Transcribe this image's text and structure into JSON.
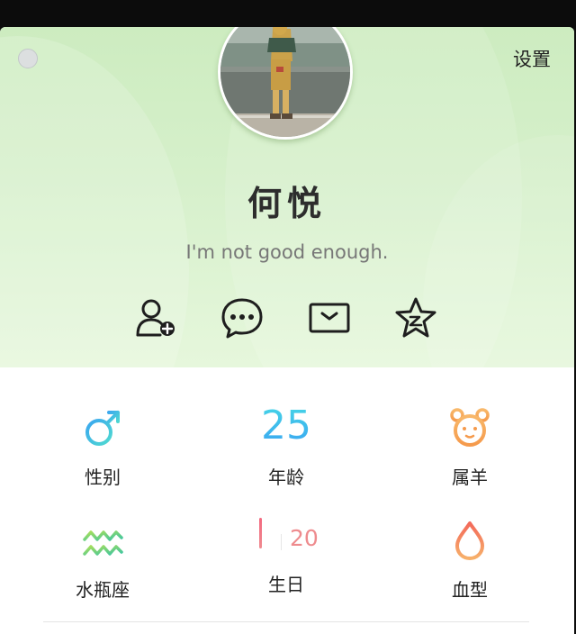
{
  "header": {
    "settings_label": "设置"
  },
  "profile": {
    "name": "何悦",
    "signature": "I'm not good enough."
  },
  "actions": [
    {
      "icon": "add-friend-icon"
    },
    {
      "icon": "chat-bubble-icon"
    },
    {
      "icon": "mail-icon"
    },
    {
      "icon": "star-icon"
    }
  ],
  "info": {
    "gender": {
      "label": "性别",
      "icon": "male-symbol-icon"
    },
    "age": {
      "label": "年龄",
      "value": "25"
    },
    "zodiac": {
      "label": "属羊",
      "icon": "sheep-icon"
    },
    "constellation": {
      "label": "水瓶座",
      "icon": "aquarius-icon"
    },
    "birthday": {
      "label": "生日",
      "day": "20"
    },
    "blood_type": {
      "label": "血型",
      "icon": "blood-drop-icon"
    }
  },
  "colors": {
    "hero_green": "#cdecc0",
    "gender_cyan": "#3cc7e0",
    "age_blue": "#3aa3f2",
    "zodiac_orange": "#f6a25a",
    "aquarius_green": "#7fd36b",
    "birthday_pink": "#ee8b8e",
    "blood_orange": "#f5845c"
  }
}
